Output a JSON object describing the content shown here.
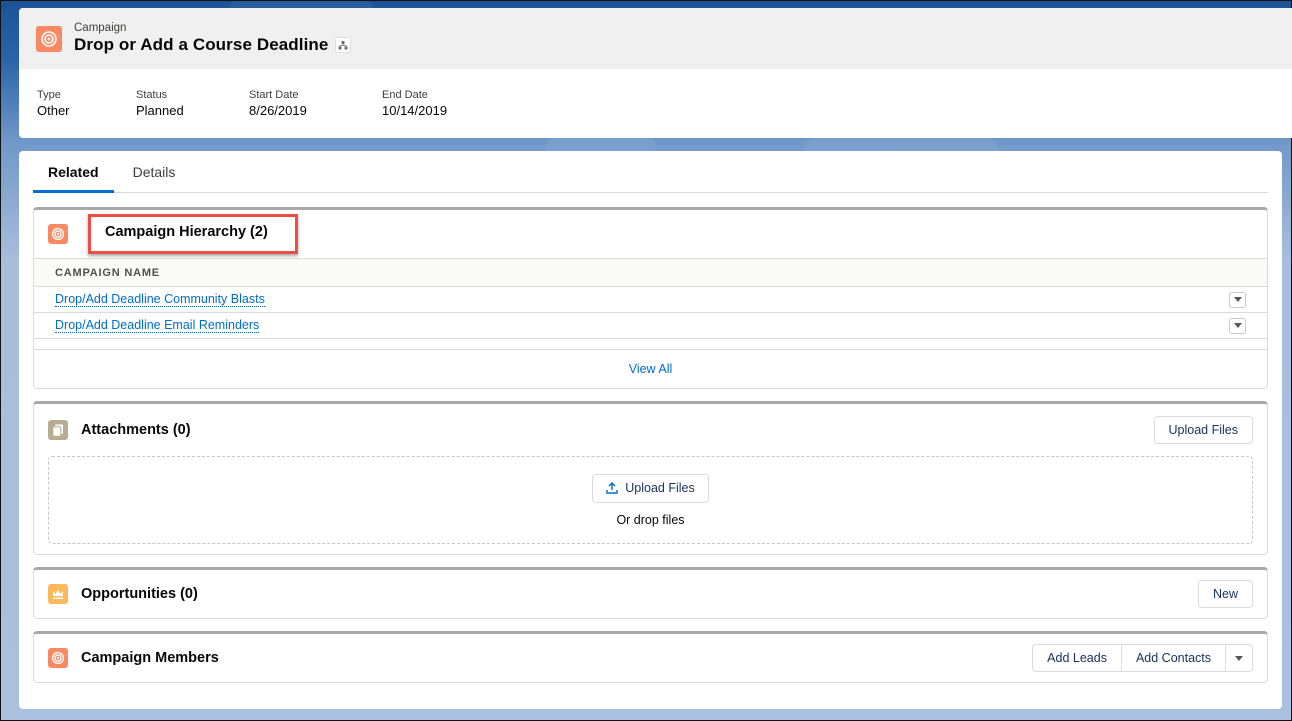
{
  "header": {
    "object_label": "Campaign",
    "title": "Drop or Add a Course Deadline",
    "icon": "campaign-target-icon",
    "hierarchy_button_icon": "hierarchy-icon",
    "fields": [
      {
        "label": "Type",
        "value": "Other"
      },
      {
        "label": "Status",
        "value": "Planned"
      },
      {
        "label": "Start Date",
        "value": "8/26/2019"
      },
      {
        "label": "End Date",
        "value": "10/14/2019"
      }
    ]
  },
  "tabs": [
    {
      "label": "Related",
      "active": true
    },
    {
      "label": "Details",
      "active": false
    }
  ],
  "related_lists": {
    "campaign_hierarchy": {
      "title": "Campaign Hierarchy (2)",
      "icon": "campaign-target-icon",
      "column_header": "CAMPAIGN NAME",
      "rows": [
        {
          "name": "Drop/Add Deadline Community Blasts"
        },
        {
          "name": "Drop/Add Deadline Email Reminders"
        }
      ],
      "view_all": "View All"
    },
    "attachments": {
      "title": "Attachments (0)",
      "icon": "file-icon",
      "upload_button": "Upload Files",
      "dropzone_button": "Upload Files",
      "dropzone_button_icon": "upload-icon",
      "dropzone_text": "Or drop files"
    },
    "opportunities": {
      "title": "Opportunities (0)",
      "icon": "crown-icon",
      "new_button": "New"
    },
    "campaign_members": {
      "title": "Campaign Members",
      "icon": "campaign-target-icon",
      "add_leads_button": "Add Leads",
      "add_contacts_button": "Add Contacts"
    }
  },
  "colors": {
    "campaign_icon": "#f88962",
    "file_icon": "#baac93",
    "opportunity_icon": "#fcb95b",
    "link": "#006dcc",
    "active_tab": "#0070d2",
    "highlight": "#ef4c45"
  }
}
